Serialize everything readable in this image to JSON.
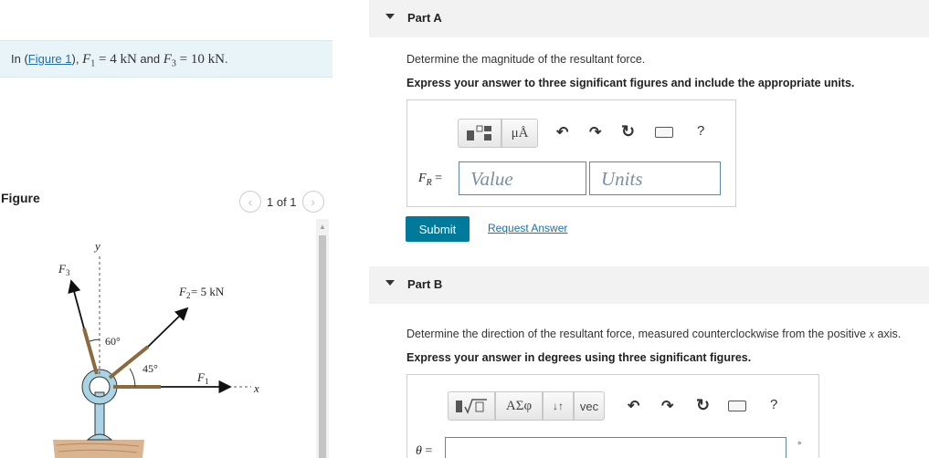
{
  "problem": {
    "prefix": "In (",
    "figure_link": "Figure 1",
    "mid": "), ",
    "f1_symbol": "F",
    "f1_sub": "1",
    "f1_value": " = 4 kN",
    "and": " and ",
    "f3_symbol": "F",
    "f3_sub": "3",
    "f3_value": " = 10 kN",
    "end": "."
  },
  "figure": {
    "label": "Figure",
    "pager_text": "1 of 1",
    "prev_icon": "chevron-left-icon",
    "next_icon": "chevron-right-icon",
    "labels": {
      "y": "y",
      "x": "x",
      "f3": "F",
      "f3_sub": "3",
      "f2": "F",
      "f2_sub": "2",
      "f2_value": " = 5 kN",
      "f1": "F",
      "f1_sub": "1",
      "angle60": "60°",
      "angle45": "45°"
    }
  },
  "partA": {
    "title": "Part A",
    "question": "Determine the magnitude of the resultant force.",
    "instruction": "Express your answer to three significant figures and include the appropriate units.",
    "toolbar": {
      "templates_icon": "templates-icon",
      "units_label": "μÅ",
      "undo_icon": "undo-icon",
      "redo_icon": "redo-icon",
      "reset_icon": "reset-icon",
      "keyboard_icon": "keyboard-icon",
      "help_label": "?"
    },
    "field_label": "F",
    "field_sub": "R",
    "field_eq": " =",
    "value_placeholder": "Value",
    "units_placeholder": "Units",
    "submit_label": "Submit",
    "request_label": "Request Answer"
  },
  "partB": {
    "title": "Part B",
    "question_pre": "Determine the direction of the resultant force, measured counterclockwise from the positive ",
    "question_var": "x",
    "question_post": " axis.",
    "instruction": "Express your answer in degrees using three significant figures.",
    "toolbar": {
      "sqrt_icon": "sqrt-template-icon",
      "greek_label": "ΑΣφ",
      "arrows_label": "↓↑",
      "vec_label": "vec",
      "undo_icon": "undo-icon",
      "redo_icon": "redo-icon",
      "reset_icon": "reset-icon",
      "keyboard_icon": "keyboard-icon",
      "help_label": "?"
    },
    "field_label": "θ",
    "field_eq": " =",
    "degree_symbol": "°"
  },
  "colors": {
    "accent": "#007a9a",
    "link": "#1f6fa8",
    "problem_bg": "#e8f4f7",
    "header_bg": "#f2f2f2"
  }
}
